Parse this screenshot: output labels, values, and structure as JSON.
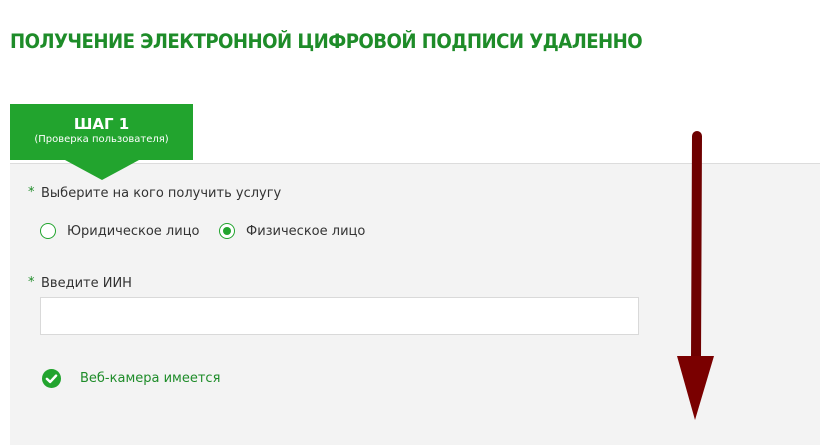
{
  "page": {
    "title": "ПОЛУЧЕНИЕ ЭЛЕКТРОННОЙ ЦИФРОВОЙ ПОДПИСИ УДАЛЕННО"
  },
  "step": {
    "title": "ШАГ 1",
    "subtitle": "(Проверка пользователя)"
  },
  "form": {
    "required_mark": "*",
    "applicant_type": {
      "label": "Выберите на кого получить услугу",
      "options": [
        {
          "label": "Юридическое лицо",
          "selected": false
        },
        {
          "label": "Физическое лицо",
          "selected": true
        }
      ]
    },
    "iin": {
      "label": "Введите ИИН",
      "value": "",
      "placeholder": ""
    },
    "webcam": {
      "status_text": "Веб-камера имеется",
      "icon": "check-circle-icon"
    }
  },
  "annotation": {
    "icon": "down-arrow-icon",
    "color": "#7a0000"
  },
  "colors": {
    "brand_green": "#22a42e",
    "title_green": "#1e8c29",
    "panel_bg": "#f3f3f3"
  }
}
